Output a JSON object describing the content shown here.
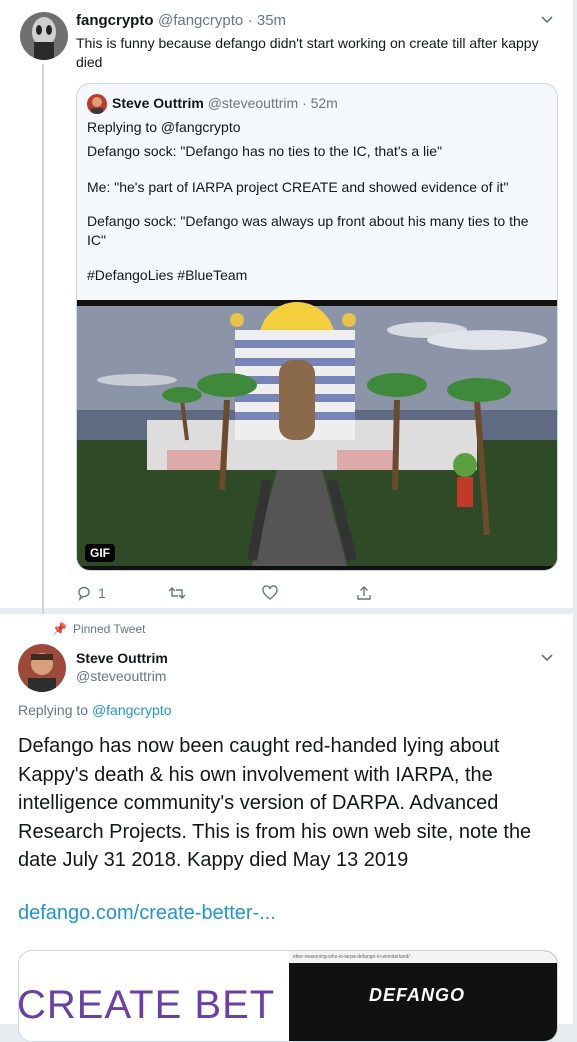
{
  "tweet1": {
    "name": "fangcrypto",
    "handle": "@fangcrypto",
    "time": "· 35m",
    "text": "This is funny because defango didn't start working on create till after kappy died"
  },
  "quote": {
    "name": "Steve Outtrim",
    "handle": "@steveouttrim",
    "time": "· 52m",
    "replying": "Replying to @fangcrypto",
    "lines": [
      "Defango sock: \"Defango has no ties to the IC, that's a lie\"",
      "Me: \"he's part of IARPA project CREATE and showed evidence of it\"",
      "Defango sock: \"Defango was always up front about his many ties to the IC\"",
      "#DefangoLies #BlueTeam"
    ],
    "gif_badge": "GIF"
  },
  "actions": {
    "reply_count": "1"
  },
  "tweet2": {
    "pinned": "Pinned Tweet",
    "name": "Steve Outtrim",
    "handle": "@steveouttrim",
    "replying_prefix": "Replying to",
    "replying_handle": "@fangcrypto",
    "text": "Defango has now been caught red-handed lying about Kappy's death & his own involvement with IARPA, the intelligence community's version of DARPA. Advanced Research Projects. This is from his own web site, note the date July 31 2018. Kappy died May 13 2019",
    "link": "defango.com/create-better-...",
    "card_left_text": "CREATE BET",
    "card_url": "etter-reasoning-who-is-iarpa-defango-in-wonderland/",
    "card_brand": "DEFANGO"
  },
  "colors": {
    "link": "#1b95e0",
    "muted": "#657786",
    "border": "#ccd6dd"
  }
}
